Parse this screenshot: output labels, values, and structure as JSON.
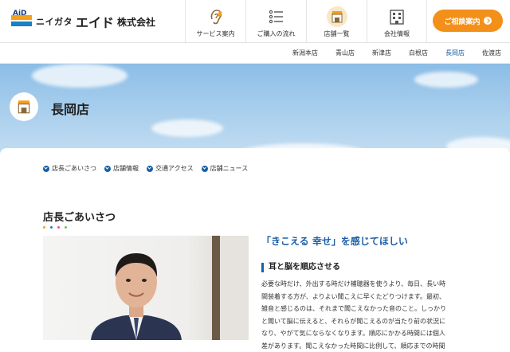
{
  "header": {
    "logo_mark": "AiD",
    "logo_prefix": "ニイガタ",
    "logo_brand": "エイド",
    "logo_suffix": "株式会社",
    "nav": [
      {
        "label": "サービス案内",
        "icon": "ear-icon"
      },
      {
        "label": "ご購入の流れ",
        "icon": "checklist-icon"
      },
      {
        "label": "店舗一覧",
        "icon": "shop-icon"
      },
      {
        "label": "会社情報",
        "icon": "building-icon"
      }
    ],
    "consult_label": "ご相談案内"
  },
  "store_nav": [
    "新潟本店",
    "青山店",
    "新津店",
    "白根店",
    "長岡店",
    "佐渡店"
  ],
  "store_nav_active": "長岡店",
  "hero": {
    "title": "長岡店",
    "icon": "shop-icon"
  },
  "anchors": [
    "店長ごあいさつ",
    "店舗情報",
    "交通アクセス",
    "店舗ニュース"
  ],
  "section": {
    "title": "店長ごあいさつ",
    "dot_colors": [
      "#f5a01a",
      "#1b7fc4",
      "#e85a8a",
      "#7bc043"
    ],
    "catch": "「きこえる 幸せ」を感じてほしい",
    "subhead": "耳と脳を順応させる",
    "body_lines": [
      "必要な時だけ、外出する時だけ補聴器を使うより、毎日、長い時",
      "間装着する方が、よりよい聞こえに早くたどりつけます。最初、",
      "雑音と感じるのは、それまで聞こえなかった音のこと。しっかり",
      "と聞いて脳に伝えると、それらが聞こえるのが当たり前の状況に",
      "なり、やがて気にならなくなります。順応にかかる時間には個人",
      "差があります。聞こえなかった時間に比例して、順応までの時間"
    ]
  },
  "colors": {
    "accent_orange": "#f3901a",
    "brand_blue": "#1b5fa7"
  }
}
